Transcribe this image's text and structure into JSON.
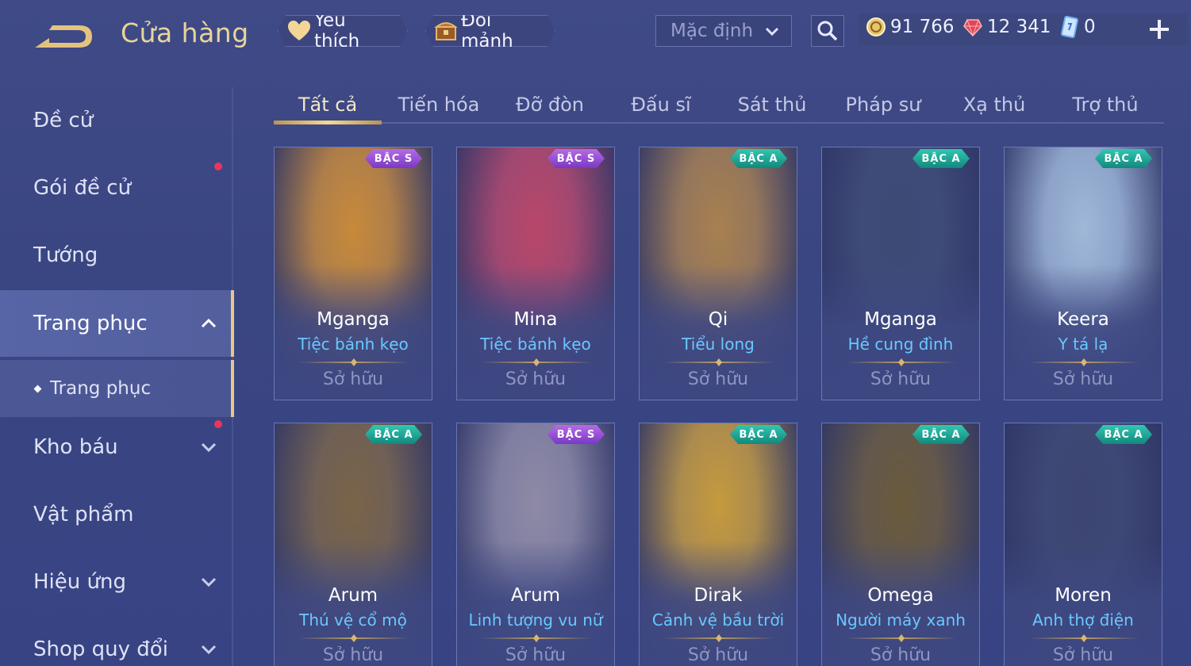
{
  "header": {
    "title": "Cửa hàng",
    "favorites_label": "Yêu thích",
    "exchange_label": "Đổi mảnh",
    "sort_value": "Mặc định"
  },
  "currency": {
    "gold": "91 766",
    "gems": "12 341",
    "vouchers": "0"
  },
  "sidebar": {
    "items": [
      {
        "label": "Đề cử"
      },
      {
        "label": "Gói đề cử"
      },
      {
        "label": "Tướng"
      },
      {
        "label": "Trang phục"
      },
      {
        "label": "Trang phục"
      },
      {
        "label": "Kho báu"
      },
      {
        "label": "Vật phẩm"
      },
      {
        "label": "Hiệu ứng"
      },
      {
        "label": "Shop quy đổi"
      }
    ]
  },
  "tabs": [
    "Tất cả",
    "Tiến hóa",
    "Đỡ đòn",
    "Đấu sĩ",
    "Sát thủ",
    "Pháp sư",
    "Xạ thủ",
    "Trợ thủ"
  ],
  "cards": [
    {
      "name": "Mganga",
      "skin": "Tiệc bánh kẹo",
      "badge": "BẬC S",
      "status": "Sở hữu",
      "color": "#c88a3a"
    },
    {
      "name": "Mina",
      "skin": "Tiệc bánh kẹo",
      "badge": "BẬC S",
      "status": "Sở hữu",
      "color": "#b8476a"
    },
    {
      "name": "Qi",
      "skin": "Tiểu long",
      "badge": "BẬC A",
      "status": "Sở hữu",
      "color": "#a88050"
    },
    {
      "name": "Mganga",
      "skin": "Hề cung đình",
      "badge": "BẬC A",
      "status": "Sở hữu",
      "color": "#3d4a74"
    },
    {
      "name": "Keera",
      "skin": "Y tá lạ",
      "badge": "BẬC A",
      "status": "Sở hữu",
      "color": "#9fb8d8"
    },
    {
      "name": "Arum",
      "skin": "Thú vệ cổ mộ",
      "badge": "BẬC A",
      "status": "Sở hữu",
      "color": "#7a6448"
    },
    {
      "name": "Arum",
      "skin": "Linh tượng vu nữ",
      "badge": "BẬC S",
      "status": "Sở hữu",
      "color": "#8e8aa6"
    },
    {
      "name": "Dirak",
      "skin": "Cảnh vệ bầu trời",
      "badge": "BẬC A",
      "status": "Sở hữu",
      "color": "#c59a3e"
    },
    {
      "name": "Omega",
      "skin": "Người máy xanh",
      "badge": "BẬC A",
      "status": "Sở hữu",
      "color": "#6a5a3c"
    },
    {
      "name": "Moren",
      "skin": "Anh thợ điện",
      "badge": "BẬC A",
      "status": "Sở hữu",
      "color": "#3c4670"
    }
  ],
  "colors": {
    "accent_gold": "#e6c986",
    "skin_name_blue": "#69c8ff",
    "badge_s": "#9a4fd6",
    "badge_a": "#1fa896",
    "notification_dot": "#e8365d"
  }
}
